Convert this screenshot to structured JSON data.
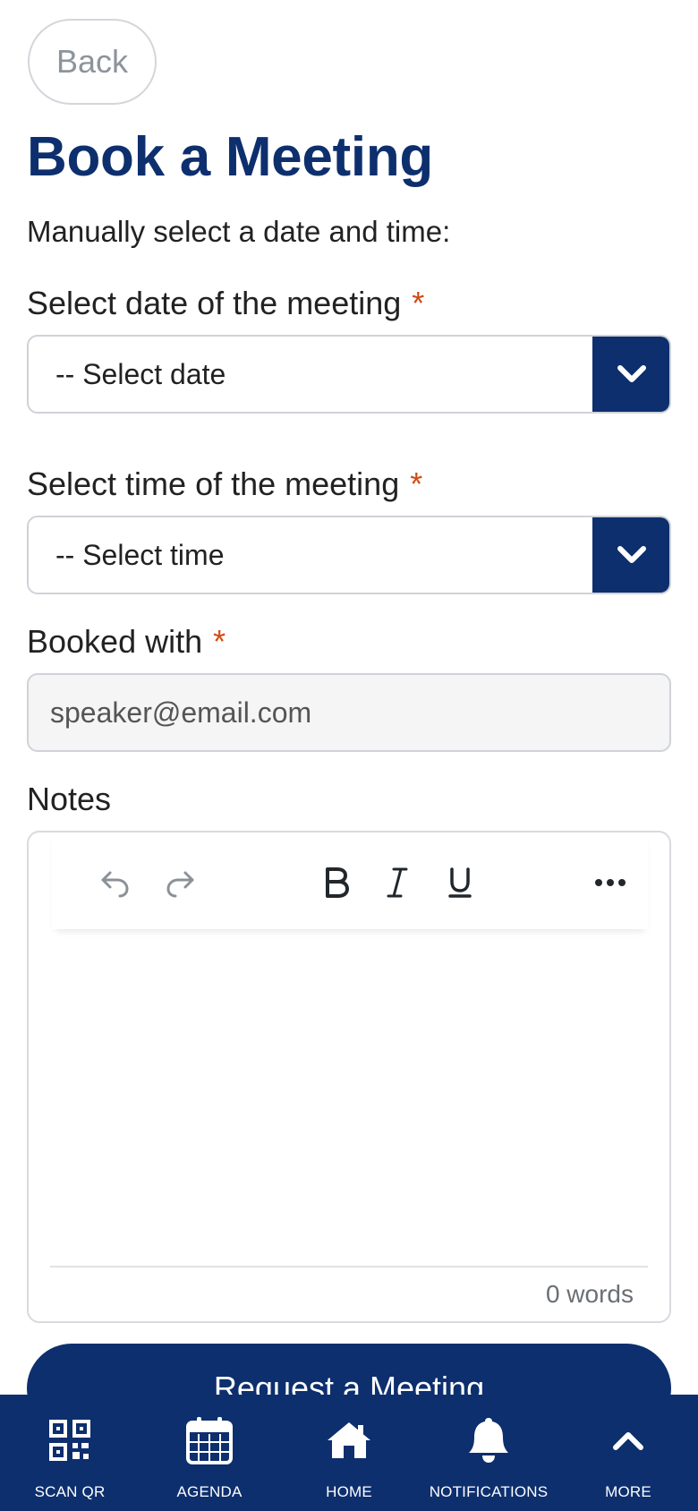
{
  "header": {
    "back_label": "Back",
    "title": "Book a Meeting",
    "intro": "Manually select a date and time:"
  },
  "form": {
    "required_marker": "*",
    "date": {
      "label": "Select date of the meeting",
      "value": "-- Select date"
    },
    "time": {
      "label": "Select time of the meeting",
      "value": "-- Select time"
    },
    "booked_with": {
      "label": "Booked with",
      "value": "speaker@email.com"
    },
    "notes": {
      "label": "Notes",
      "word_count": "0 words"
    },
    "submit_label": "Request a Meeting"
  },
  "editor_toolbar": [
    "undo-icon",
    "redo-icon",
    "bold-icon",
    "italic-icon",
    "underline-icon",
    "more-icon"
  ],
  "bottom_nav": {
    "items": [
      {
        "label": "SCAN QR",
        "icon": "qr-code-icon"
      },
      {
        "label": "AGENDA",
        "icon": "calendar-icon"
      },
      {
        "label": "HOME",
        "icon": "home-icon"
      },
      {
        "label": "NOTIFICATIONS",
        "icon": "bell-icon"
      },
      {
        "label": "MORE",
        "icon": "chevron-up-icon"
      }
    ]
  },
  "colors": {
    "brand_navy": "#0d2f6e",
    "required_red": "#d24a12",
    "border_gray": "#cfd3d8",
    "input_bg": "#f5f5f5"
  }
}
